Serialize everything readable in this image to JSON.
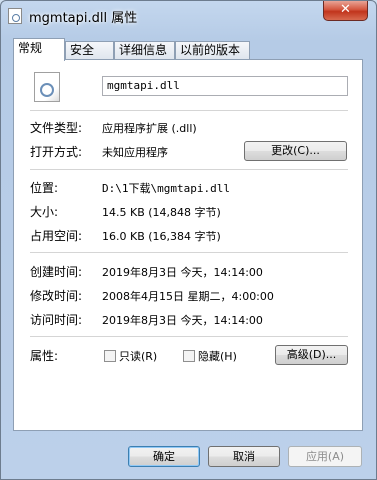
{
  "window": {
    "title": "mgmtapi.dll 属性",
    "close_label": "✕"
  },
  "tabs": [
    {
      "label": "常规",
      "active": true
    },
    {
      "label": "安全",
      "active": false
    },
    {
      "label": "详细信息",
      "active": false
    },
    {
      "label": "以前的版本",
      "active": false
    }
  ],
  "general": {
    "file_name": "mgmtapi.dll",
    "file_type_label": "文件类型:",
    "file_type_value": "应用程序扩展 (.dll)",
    "opens_with_label": "打开方式:",
    "opens_with_value": "未知应用程序",
    "change_button": "更改(C)...",
    "location_label": "位置:",
    "location_value": "D:\\1下载\\mgmtapi.dll",
    "size_label": "大小:",
    "size_value": "14.5 KB (14,848 字节)",
    "size_on_disk_label": "占用空间:",
    "size_on_disk_value": "16.0 KB (16,384 字节)",
    "created_label": "创建时间:",
    "created_value": "2019年8月3日 今天，14:14:00",
    "modified_label": "修改时间:",
    "modified_value": "2008年4月15日 星期二，4:00:00",
    "accessed_label": "访问时间:",
    "accessed_value": "2019年8月3日 今天，14:14:00",
    "attributes_label": "属性:",
    "readonly_label": "只读(R)",
    "readonly_checked": false,
    "hidden_label": "隐藏(H)",
    "hidden_checked": false,
    "advanced_button": "高级(D)..."
  },
  "footer": {
    "ok": "确定",
    "cancel": "取消",
    "apply": "应用(A)"
  }
}
